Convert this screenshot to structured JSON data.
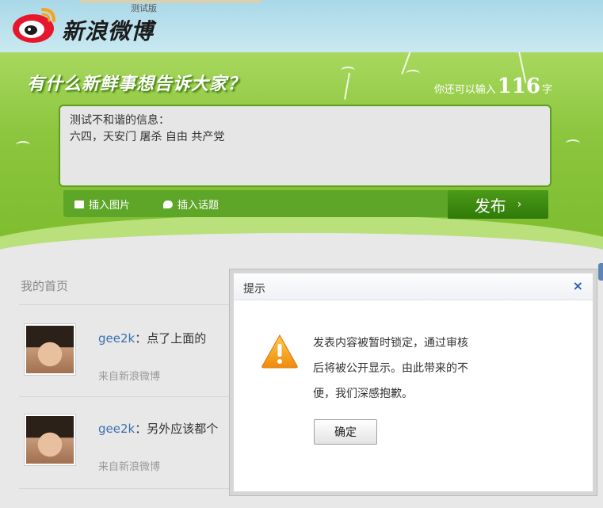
{
  "header": {
    "logo_text": "新浪微博",
    "beta_label": "测试版"
  },
  "publisher": {
    "slogan": "有什么新鲜事想告诉大家？",
    "counter_prefix": "你还可以输入",
    "counter_value": "116",
    "counter_suffix": "字",
    "text_line1": "测试不和谐的信息：",
    "text_line2": "六四，天安门 屠杀 自由 共产党",
    "insert_image_label": "插入图片",
    "insert_topic_label": "插入话题",
    "publish_label": "发布",
    "publish_arrow": "›"
  },
  "feed": {
    "title": "我的首页",
    "items": [
      {
        "user": "gee2k",
        "sep": "：",
        "text": "点了上面的",
        "source": "来自新浪微博"
      },
      {
        "user": "gee2k",
        "sep": "：",
        "text": "另外应该都个",
        "source": "来自新浪微博"
      }
    ]
  },
  "dialog": {
    "title": "提示",
    "close": "×",
    "message_line1": "发表内容被暂时锁定，通过审核",
    "message_line2": "后将被公开显示。由此带来的不",
    "message_line3": "便，我们深感抱歉。",
    "ok_label": "确定"
  },
  "colors": {
    "green": "#7dbb2e",
    "publish": "#2f7a09",
    "link": "#3a6fb0",
    "warning": "#f39c12"
  }
}
